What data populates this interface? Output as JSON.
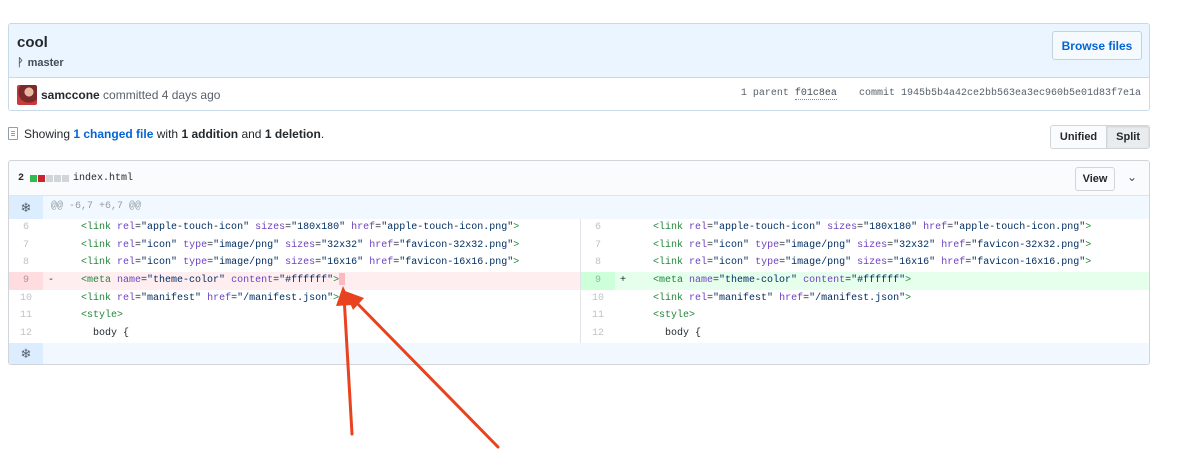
{
  "commit": {
    "title": "cool",
    "branch": "master",
    "browse_label": "Browse files",
    "author": "samccone",
    "committed_text": "committed 4 days ago",
    "parent_label": "1 parent",
    "parent_sha": "f01c8ea",
    "commit_label": "commit",
    "commit_sha": "1945b5b4a42ce2bb563ea3ec960b5e01d83f7e1a"
  },
  "toolbar": {
    "showing": "Showing",
    "changed_files": "1 changed file",
    "with": "with",
    "additions": "1 addition",
    "and": "and",
    "deletions": "1 deletion",
    "period": ".",
    "unified_label": "Unified",
    "split_label": "Split"
  },
  "file": {
    "count": "2",
    "name": "index.html",
    "view_label": "View",
    "hunk_header": "@@ -6,7 +6,7 @@",
    "diffstat_colors": [
      "#2cbe4e",
      "#cb2431",
      "#d1d5da",
      "#d1d5da",
      "#d1d5da"
    ]
  },
  "diff": {
    "lines": [
      {
        "left_num": "6",
        "right_num": "6",
        "left_type": "ctx",
        "right_type": "ctx",
        "left": [
          [
            "t",
            "<link "
          ],
          [
            "a",
            "rel"
          ],
          [
            "p",
            "="
          ],
          [
            "s",
            "\"apple-touch-icon\""
          ],
          [
            "p",
            " "
          ],
          [
            "a",
            "sizes"
          ],
          [
            "p",
            "="
          ],
          [
            "s",
            "\"180x180\""
          ],
          [
            "p",
            " "
          ],
          [
            "a",
            "href"
          ],
          [
            "p",
            "="
          ],
          [
            "s",
            "\"apple-touch-icon.png\""
          ],
          [
            "t",
            ">"
          ]
        ],
        "right": [
          [
            "t",
            "<link "
          ],
          [
            "a",
            "rel"
          ],
          [
            "p",
            "="
          ],
          [
            "s",
            "\"apple-touch-icon\""
          ],
          [
            "p",
            " "
          ],
          [
            "a",
            "sizes"
          ],
          [
            "p",
            "="
          ],
          [
            "s",
            "\"180x180\""
          ],
          [
            "p",
            " "
          ],
          [
            "a",
            "href"
          ],
          [
            "p",
            "="
          ],
          [
            "s",
            "\"apple-touch-icon.png\""
          ],
          [
            "t",
            ">"
          ]
        ]
      },
      {
        "left_num": "7",
        "right_num": "7",
        "left_type": "ctx",
        "right_type": "ctx",
        "left": [
          [
            "t",
            "<link "
          ],
          [
            "a",
            "rel"
          ],
          [
            "p",
            "="
          ],
          [
            "s",
            "\"icon\""
          ],
          [
            "p",
            " "
          ],
          [
            "a",
            "type"
          ],
          [
            "p",
            "="
          ],
          [
            "s",
            "\"image/png\""
          ],
          [
            "p",
            " "
          ],
          [
            "a",
            "sizes"
          ],
          [
            "p",
            "="
          ],
          [
            "s",
            "\"32x32\""
          ],
          [
            "p",
            " "
          ],
          [
            "a",
            "href"
          ],
          [
            "p",
            "="
          ],
          [
            "s",
            "\"favicon-32x32.png\""
          ],
          [
            "t",
            ">"
          ]
        ],
        "right": [
          [
            "t",
            "<link "
          ],
          [
            "a",
            "rel"
          ],
          [
            "p",
            "="
          ],
          [
            "s",
            "\"icon\""
          ],
          [
            "p",
            " "
          ],
          [
            "a",
            "type"
          ],
          [
            "p",
            "="
          ],
          [
            "s",
            "\"image/png\""
          ],
          [
            "p",
            " "
          ],
          [
            "a",
            "sizes"
          ],
          [
            "p",
            "="
          ],
          [
            "s",
            "\"32x32\""
          ],
          [
            "p",
            " "
          ],
          [
            "a",
            "href"
          ],
          [
            "p",
            "="
          ],
          [
            "s",
            "\"favicon-32x32.png\""
          ],
          [
            "t",
            ">"
          ]
        ]
      },
      {
        "left_num": "8",
        "right_num": "8",
        "left_type": "ctx",
        "right_type": "ctx",
        "left": [
          [
            "t",
            "<link "
          ],
          [
            "a",
            "rel"
          ],
          [
            "p",
            "="
          ],
          [
            "s",
            "\"icon\""
          ],
          [
            "p",
            " "
          ],
          [
            "a",
            "type"
          ],
          [
            "p",
            "="
          ],
          [
            "s",
            "\"image/png\""
          ],
          [
            "p",
            " "
          ],
          [
            "a",
            "sizes"
          ],
          [
            "p",
            "="
          ],
          [
            "s",
            "\"16x16\""
          ],
          [
            "p",
            " "
          ],
          [
            "a",
            "href"
          ],
          [
            "p",
            "="
          ],
          [
            "s",
            "\"favicon-16x16.png\""
          ],
          [
            "t",
            ">"
          ]
        ],
        "right": [
          [
            "t",
            "<link "
          ],
          [
            "a",
            "rel"
          ],
          [
            "p",
            "="
          ],
          [
            "s",
            "\"icon\""
          ],
          [
            "p",
            " "
          ],
          [
            "a",
            "type"
          ],
          [
            "p",
            "="
          ],
          [
            "s",
            "\"image/png\""
          ],
          [
            "p",
            " "
          ],
          [
            "a",
            "sizes"
          ],
          [
            "p",
            "="
          ],
          [
            "s",
            "\"16x16\""
          ],
          [
            "p",
            " "
          ],
          [
            "a",
            "href"
          ],
          [
            "p",
            "="
          ],
          [
            "s",
            "\"favicon-16x16.png\""
          ],
          [
            "t",
            ">"
          ]
        ]
      },
      {
        "left_num": "9",
        "right_num": "9",
        "left_type": "del",
        "right_type": "add",
        "left_sign": "-",
        "right_sign": "+",
        "left": [
          [
            "t",
            "<meta "
          ],
          [
            "a",
            "name"
          ],
          [
            "p",
            "="
          ],
          [
            "s",
            "\"theme-color\""
          ],
          [
            "p",
            " "
          ],
          [
            "a",
            "content"
          ],
          [
            "p",
            "="
          ],
          [
            "s",
            "\"#ffffff\""
          ],
          [
            "t",
            ">"
          ],
          [
            "h",
            ""
          ]
        ],
        "right": [
          [
            "t",
            "<meta "
          ],
          [
            "a",
            "name"
          ],
          [
            "p",
            "="
          ],
          [
            "s",
            "\"theme-color\""
          ],
          [
            "p",
            " "
          ],
          [
            "a",
            "content"
          ],
          [
            "p",
            "="
          ],
          [
            "s",
            "\"#ffffff\""
          ],
          [
            "t",
            ">"
          ]
        ]
      },
      {
        "left_num": "10",
        "right_num": "10",
        "left_type": "ctx",
        "right_type": "ctx",
        "left": [
          [
            "t",
            "<link "
          ],
          [
            "a",
            "rel"
          ],
          [
            "p",
            "="
          ],
          [
            "s",
            "\"manifest\""
          ],
          [
            "p",
            " "
          ],
          [
            "a",
            "href"
          ],
          [
            "p",
            "="
          ],
          [
            "s",
            "\"/manifest.json\""
          ],
          [
            "t",
            ">"
          ]
        ],
        "right": [
          [
            "t",
            "<link "
          ],
          [
            "a",
            "rel"
          ],
          [
            "p",
            "="
          ],
          [
            "s",
            "\"manifest\""
          ],
          [
            "p",
            " "
          ],
          [
            "a",
            "href"
          ],
          [
            "p",
            "="
          ],
          [
            "s",
            "\"/manifest.json\""
          ],
          [
            "t",
            ">"
          ]
        ]
      },
      {
        "left_num": "11",
        "right_num": "11",
        "left_type": "ctx",
        "right_type": "ctx",
        "left": [
          [
            "t",
            "<style>"
          ]
        ],
        "right": [
          [
            "t",
            "<style>"
          ]
        ]
      },
      {
        "left_num": "12",
        "right_num": "12",
        "left_type": "ctx",
        "right_type": "ctx",
        "left": [
          [
            "p",
            "  body {"
          ]
        ],
        "right": [
          [
            "p",
            "  body {"
          ]
        ]
      }
    ]
  },
  "colors": {
    "link_blue": "#0366d6",
    "deletion_bg": "#ffeef0",
    "addition_bg": "#e6ffed",
    "annotation_arrow": "#e8431e"
  }
}
